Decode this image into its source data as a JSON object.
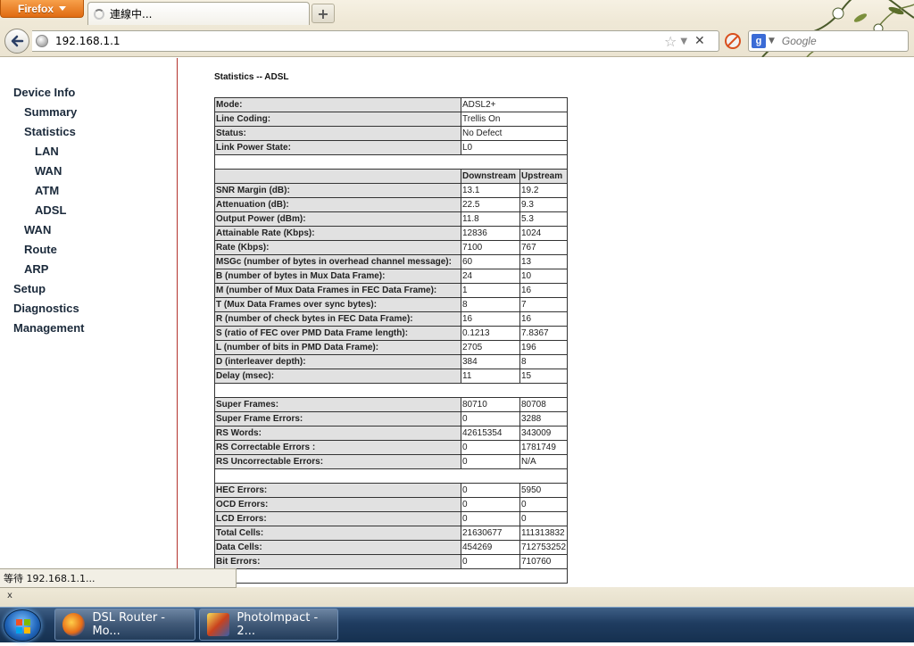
{
  "browser": {
    "menu_label": "Firefox",
    "tab_title": "連線中...",
    "new_tab_label": "+",
    "url": "192.168.1.1",
    "search_engine": "g",
    "search_placeholder": "Google"
  },
  "sidebar": {
    "items": [
      {
        "label": "Device Info"
      },
      {
        "label": "Summary"
      },
      {
        "label": "Statistics"
      },
      {
        "label": "LAN"
      },
      {
        "label": "WAN"
      },
      {
        "label": "ATM"
      },
      {
        "label": "ADSL"
      },
      {
        "label": "WAN"
      },
      {
        "label": "Route"
      },
      {
        "label": "ARP"
      },
      {
        "label": "Setup"
      },
      {
        "label": "Diagnostics"
      },
      {
        "label": "Management"
      }
    ]
  },
  "main": {
    "heading": "Statistics -- ADSL",
    "column_headers": [
      "Downstream",
      "Upstream"
    ],
    "info_rows": [
      {
        "label": "Mode:",
        "value": "ADSL2+"
      },
      {
        "label": "Line Coding:",
        "value": "Trellis On"
      },
      {
        "label": "Status:",
        "value": "No Defect"
      },
      {
        "label": "Link Power State:",
        "value": "L0"
      }
    ],
    "line_rows": [
      {
        "label": "SNR Margin (dB):",
        "down": "13.1",
        "up": "19.2"
      },
      {
        "label": "Attenuation (dB):",
        "down": "22.5",
        "up": "9.3"
      },
      {
        "label": "Output Power (dBm):",
        "down": "11.8",
        "up": "5.3"
      },
      {
        "label": "Attainable Rate (Kbps):",
        "down": "12836",
        "up": "1024"
      },
      {
        "label": "Rate (Kbps):",
        "down": "7100",
        "up": "767"
      },
      {
        "label": "MSGc (number of bytes in overhead channel message):",
        "down": "60",
        "up": "13"
      },
      {
        "label": "B (number of bytes in Mux Data Frame):",
        "down": "24",
        "up": "10"
      },
      {
        "label": "M (number of Mux Data Frames in FEC Data Frame):",
        "down": "1",
        "up": "16"
      },
      {
        "label": "T (Mux Data Frames over sync bytes):",
        "down": "8",
        "up": "7"
      },
      {
        "label": "R (number of check bytes in FEC Data Frame):",
        "down": "16",
        "up": "16"
      },
      {
        "label": "S (ratio of FEC over PMD Data Frame length):",
        "down": "0.1213",
        "up": "7.8367"
      },
      {
        "label": "L (number of bits in PMD Data Frame):",
        "down": "2705",
        "up": "196"
      },
      {
        "label": "D (interleaver depth):",
        "down": "384",
        "up": "8"
      },
      {
        "label": "Delay (msec):",
        "down": "11",
        "up": "15"
      }
    ],
    "frame_rows": [
      {
        "label": "Super Frames:",
        "down": "80710",
        "up": "80708"
      },
      {
        "label": "Super Frame Errors:",
        "down": "0",
        "up": "3288"
      },
      {
        "label": "RS Words:",
        "down": "42615354",
        "up": "343009"
      },
      {
        "label": "RS Correctable Errors :",
        "down": "0",
        "up": "1781749"
      },
      {
        "label": "RS Uncorrectable Errors:",
        "down": "0",
        "up": "N/A"
      }
    ],
    "cell_rows": [
      {
        "label": "HEC Errors:",
        "down": "0",
        "up": "5950"
      },
      {
        "label": "OCD Errors:",
        "down": "0",
        "up": "0"
      },
      {
        "label": "LCD Errors:",
        "down": "0",
        "up": "0"
      },
      {
        "label": "Total Cells:",
        "down": "21630677",
        "up": "111313832"
      },
      {
        "label": "Data Cells:",
        "down": "454269",
        "up": "712753252"
      },
      {
        "label": "Bit Errors:",
        "down": "0",
        "up": "710760"
      }
    ]
  },
  "status_bar": {
    "text": "等待 192.168.1.1...",
    "close": "x"
  },
  "taskbar": {
    "items": [
      {
        "label": "DSL Router - Mo..."
      },
      {
        "label": "PhotoImpact - 2..."
      }
    ]
  },
  "colors": {
    "accent_firefox": "#e06b12",
    "sidebar_border": "#b3322c",
    "label_cell_bg": "#e1e1e1"
  }
}
